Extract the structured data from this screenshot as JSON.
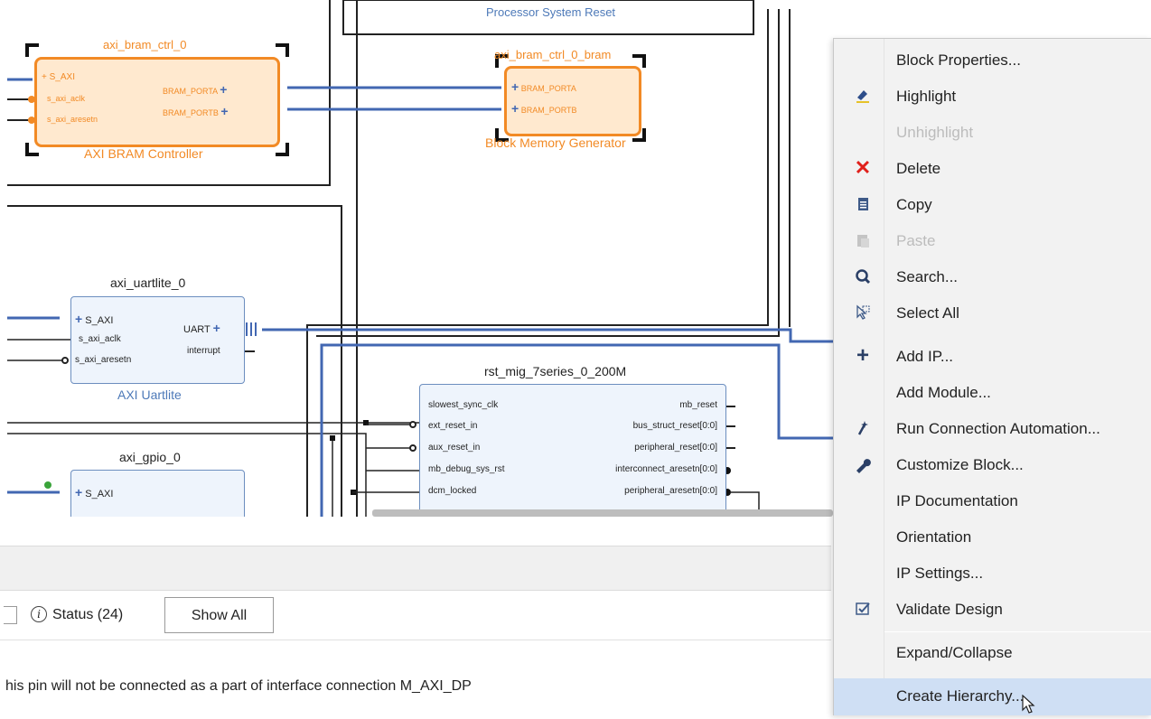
{
  "diagram": {
    "bram_ctrl": {
      "instance": "axi_bram_ctrl_0",
      "type": "AXI BRAM Controller",
      "pins_left": [
        "S_AXI",
        "s_axi_aclk",
        "s_axi_aresetn"
      ],
      "pins_right": [
        "BRAM_PORTA",
        "BRAM_PORTB"
      ]
    },
    "bram_gen": {
      "instance": "axi_bram_ctrl_0_bram",
      "type": "Block Memory Generator",
      "pins_left": [
        "BRAM_PORTA",
        "BRAM_PORTB"
      ]
    },
    "psr_label": "Processor System Reset",
    "uartlite": {
      "instance": "axi_uartlite_0",
      "type": "AXI Uartlite",
      "pins_left": [
        "S_AXI",
        "s_axi_aclk",
        "s_axi_aresetn"
      ],
      "pins_right": [
        "UART",
        "interrupt"
      ]
    },
    "gpio": {
      "instance": "axi_gpio_0",
      "pins_left": [
        "S_AXI"
      ]
    },
    "rst": {
      "instance": "rst_mig_7series_0_200M",
      "pins_left": [
        "slowest_sync_clk",
        "ext_reset_in",
        "aux_reset_in",
        "mb_debug_sys_rst",
        "dcm_locked"
      ],
      "pins_right": [
        "mb_reset",
        "bus_struct_reset[0:0]",
        "peripheral_reset[0:0]",
        "interconnect_aresetn[0:0]",
        "peripheral_aresetn[0:0]"
      ]
    }
  },
  "messages": {
    "status_label": "Status (24)",
    "show_all": "Show All",
    "message_text": "his pin will not be connected as a part of interface connection M_AXI_DP"
  },
  "context_menu": {
    "items": [
      {
        "label": "Block Properties...",
        "icon": "",
        "enabled": true
      },
      {
        "label": "Highlight",
        "icon": "highlight-icon",
        "enabled": true
      },
      {
        "label": "Unhighlight",
        "icon": "",
        "enabled": false
      },
      {
        "label": "Delete",
        "icon": "delete-icon",
        "enabled": true
      },
      {
        "label": "Copy",
        "icon": "copy-icon",
        "enabled": true
      },
      {
        "label": "Paste",
        "icon": "paste-icon",
        "enabled": false
      },
      {
        "label": "Search...",
        "icon": "search-icon",
        "enabled": true
      },
      {
        "label": "Select All",
        "icon": "select-all-icon",
        "enabled": true
      },
      {
        "label": "Add IP...",
        "icon": "add-icon",
        "enabled": true
      },
      {
        "label": "Add Module...",
        "icon": "",
        "enabled": true
      },
      {
        "label": "Run Connection Automation...",
        "icon": "wand-icon",
        "enabled": true
      },
      {
        "label": "Customize Block...",
        "icon": "wrench-icon",
        "enabled": true
      },
      {
        "label": "IP Documentation",
        "icon": "",
        "enabled": true
      },
      {
        "label": "Orientation",
        "icon": "",
        "enabled": true
      },
      {
        "label": "IP Settings...",
        "icon": "",
        "enabled": true
      },
      {
        "label": "Validate Design",
        "icon": "validate-icon",
        "enabled": true
      },
      {
        "label": "Expand/Collapse",
        "icon": "",
        "enabled": true
      },
      {
        "label": "Create Hierarchy...",
        "icon": "",
        "enabled": true,
        "hovered": true
      }
    ]
  },
  "colors": {
    "selected_orange": "#f28a25",
    "net_blue": "#4267b2",
    "menu_hover": "#cfdff4"
  }
}
